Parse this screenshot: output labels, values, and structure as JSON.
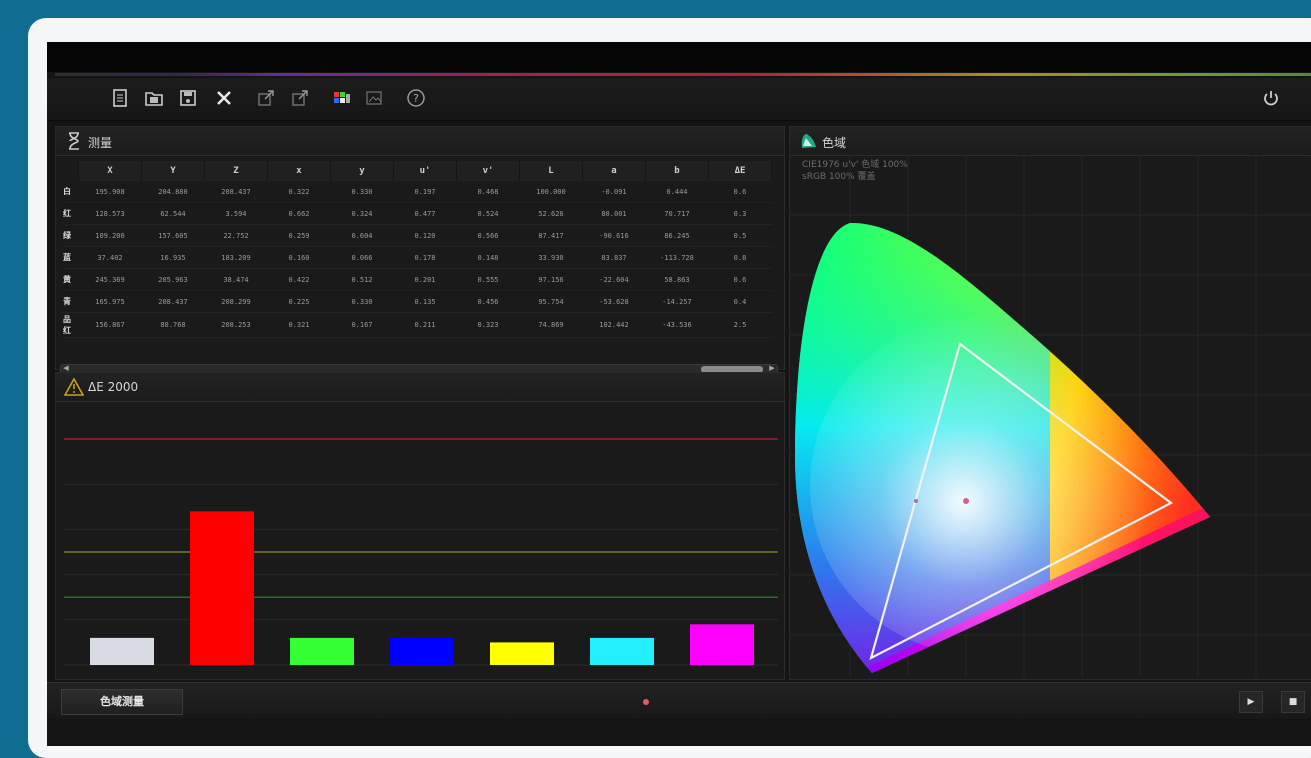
{
  "toolbar": {
    "buttons": [
      {
        "name": "new-file-icon",
        "glyph": "▤"
      },
      {
        "name": "open-folder-icon",
        "glyph": "🗀"
      },
      {
        "name": "save-icon",
        "glyph": "▣"
      },
      {
        "name": "close-icon",
        "glyph": "✕"
      },
      {
        "name": "export-icon",
        "glyph": "⇗"
      },
      {
        "name": "export-alt-icon",
        "glyph": "⇗"
      },
      {
        "name": "color-patch-icon",
        "glyph": "▦"
      },
      {
        "name": "image-icon",
        "glyph": "▨"
      },
      {
        "name": "help-icon",
        "glyph": "?"
      }
    ],
    "power_icon": "power-icon"
  },
  "measure_panel": {
    "title": "测量",
    "columns": [
      "X",
      "Y",
      "Z",
      "x",
      "y",
      "u'",
      "v'",
      "L",
      "a",
      "b",
      "ΔE"
    ],
    "rows": [
      {
        "label": "白",
        "values": [
          "195.908",
          "204.880",
          "208.437",
          "0.322",
          "0.330",
          "0.197",
          "0.468",
          "100.000",
          "-0.091",
          "0.444",
          "0.6"
        ]
      },
      {
        "label": "红",
        "values": [
          "128.573",
          "62.544",
          "3.594",
          "0.662",
          "0.324",
          "0.477",
          "0.524",
          "52.626",
          "80.001",
          "70.717",
          "0.3"
        ]
      },
      {
        "label": "绿",
        "values": [
          "109.200",
          "157.605",
          "22.752",
          "0.259",
          "0.604",
          "0.120",
          "0.566",
          "87.417",
          "-90.616",
          "86.245",
          "0.5"
        ]
      },
      {
        "label": "蓝",
        "values": [
          "37.402",
          "16.935",
          "183.209",
          "0.160",
          "0.066",
          "0.178",
          "0.148",
          "33.930",
          "83.837",
          "-113.728",
          "0.8"
        ]
      },
      {
        "label": "黄",
        "values": [
          "245.369",
          "205.963",
          "38.474",
          "0.422",
          "0.512",
          "0.201",
          "0.555",
          "97.156",
          "-22.604",
          "58.863",
          "0.6"
        ]
      },
      {
        "label": "青",
        "values": [
          "165.975",
          "208.437",
          "208.299",
          "0.225",
          "0.330",
          "0.135",
          "0.456",
          "95.754",
          "-53.628",
          "-14.257",
          "0.4"
        ]
      },
      {
        "label": "品红",
        "values": [
          "156.867",
          "80.768",
          "208.253",
          "0.321",
          "0.167",
          "0.211",
          "0.323",
          "74.869",
          "102.442",
          "-43.536",
          "2.5"
        ]
      }
    ]
  },
  "delta_panel": {
    "title": "ΔE 2000"
  },
  "gamut_panel": {
    "title": "色域",
    "note1": "CIE1976 u'v' 色域 100%",
    "note2": "sRGB 100% 覆盖"
  },
  "bottom": {
    "measure_button": "色域测量"
  },
  "chart_data": {
    "type": "bar",
    "categories": [
      "白",
      "红",
      "绿",
      "蓝",
      "黄",
      "青",
      "品红"
    ],
    "values": [
      0.6,
      3.4,
      0.6,
      0.6,
      0.5,
      0.6,
      0.9
    ],
    "colors": [
      "#d9dbe4",
      "#ff0000",
      "#33ff33",
      "#0000ff",
      "#ffff00",
      "#22f0ff",
      "#ff00ff"
    ],
    "ylim": [
      0,
      5
    ],
    "reference_lines": [
      {
        "value": 5.0,
        "color": "#a0202a"
      },
      {
        "value": 2.5,
        "color": "#7a7a20"
      },
      {
        "value": 1.5,
        "color": "#2f6a2a"
      }
    ]
  },
  "colors": {
    "accent": "#0f6d92",
    "background": "#141414"
  }
}
